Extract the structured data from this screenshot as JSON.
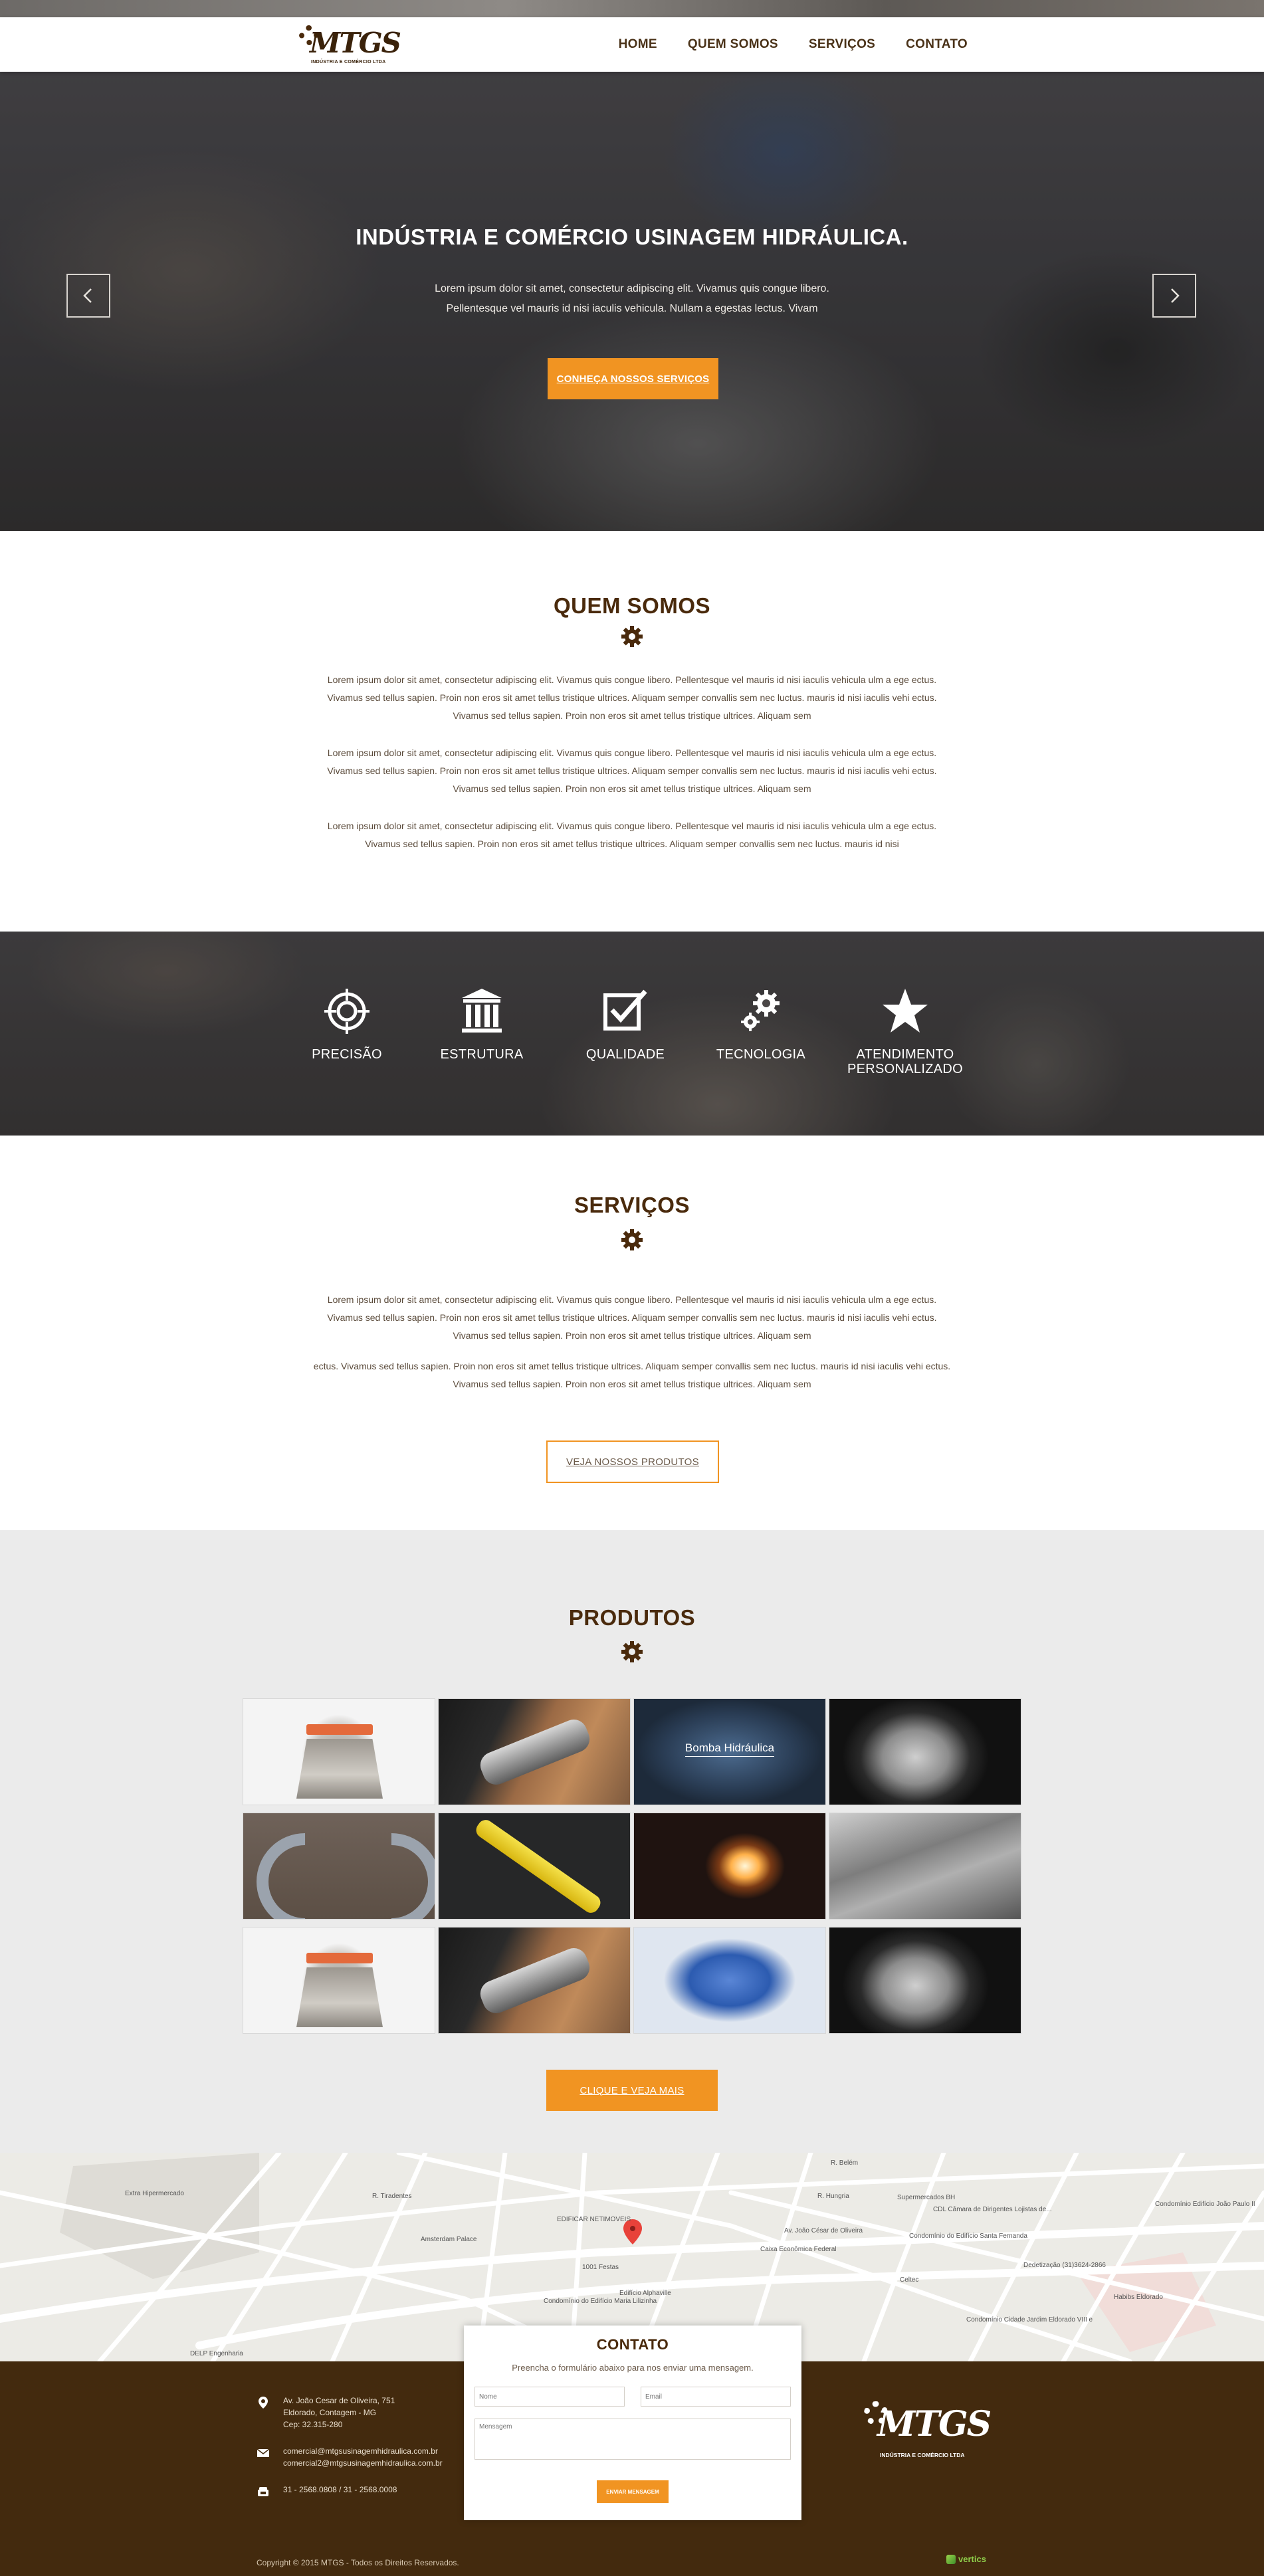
{
  "brand": {
    "name": "MTGS",
    "tagline": "INDÚSTRIA E COMÉRCIO LTDA"
  },
  "nav": {
    "items": [
      {
        "label": "HOME"
      },
      {
        "label": "QUEM SOMOS"
      },
      {
        "label": "SERVIÇOS"
      },
      {
        "label": "CONTATO"
      }
    ]
  },
  "hero": {
    "title": "INDÚSTRIA E COMÉRCIO USINAGEM HIDRÁULICA.",
    "text": "Lorem ipsum dolor sit amet, consectetur adipiscing elit. Vivamus quis congue libero. Pellentesque vel mauris id nisi iaculis vehicula. Nullam a egestas lectus. Vivam",
    "cta_label": "CONHEÇA NOSSOS SERVIÇOS",
    "prev_icon": "chevron-left-icon",
    "next_icon": "chevron-right-icon"
  },
  "about": {
    "title": "QUEM SOMOS",
    "paragraphs": [
      "Lorem ipsum dolor sit amet, consectetur adipiscing elit. Vivamus quis congue libero. Pellentesque vel mauris id nisi iaculis vehicula ulm a ege ectus. Vivamus sed tellus sapien. Proin non eros sit amet tellus tristique ultrices. Aliquam semper convallis sem nec luctus. mauris id nisi iaculis vehi  ectus. Vivamus sed tellus sapien. Proin non eros sit amet tellus tristique ultrices. Aliquam sem",
      "Lorem ipsum dolor sit amet, consectetur adipiscing elit. Vivamus quis congue libero. Pellentesque vel mauris id nisi iaculis vehicula ulm a ege ectus. Vivamus sed tellus sapien. Proin non eros sit amet tellus tristique ultrices. Aliquam semper convallis sem nec luctus. mauris id nisi iaculis vehi  ectus. Vivamus sed tellus sapien. Proin non eros sit amet tellus tristique ultrices. Aliquam sem",
      "Lorem ipsum dolor sit amet, consectetur adipiscing elit. Vivamus quis congue libero. Pellentesque vel mauris id nisi iaculis vehicula ulm a ege ectus. Vivamus sed tellus sapien. Proin non eros sit amet tellus tristique ultrices. Aliquam semper convallis sem nec luctus. mauris id nisi"
    ]
  },
  "features": [
    {
      "label": "PRECISÃO",
      "icon": "crosshair-icon"
    },
    {
      "label": "ESTRUTURA",
      "icon": "building-columns-icon"
    },
    {
      "label": "QUALIDADE",
      "icon": "checkbox-icon"
    },
    {
      "label": "TECNOLOGIA",
      "icon": "gears-icon"
    },
    {
      "label": "ATENDIMENTO PERSONALIZADO",
      "icon": "star-icon"
    }
  ],
  "services": {
    "title": "SERVIÇOS",
    "paragraphs": [
      "Lorem ipsum dolor sit amet, consectetur adipiscing elit. Vivamus quis congue libero. Pellentesque vel mauris id nisi iaculis vehicula ulm a ege ectus. Vivamus sed tellus sapien. Proin non eros sit amet tellus tristique ultrices. Aliquam semper convallis sem nec luctus. mauris id nisi iaculis vehi  ectus. Vivamus sed tellus sapien. Proin non eros sit amet tellus tristique ultrices. Aliquam sem",
      "ectus. Vivamus sed tellus sapien. Proin non eros sit amet tellus tristique ultrices. Aliquam semper convallis sem nec luctus. mauris id nisi iaculis vehi  ectus. Vivamus sed tellus sapien. Proin non eros sit amet tellus tristique ultrices. Aliquam sem"
    ],
    "button_label": "VEJA NOSSOS PRODUTOS"
  },
  "products": {
    "title": "PRODUTOS",
    "highlight_caption": "Bomba Hidráulica",
    "button_label": "CLIQUE E VEJA MAIS"
  },
  "map": {
    "labels": [
      "Extra Hipermercado",
      "Av. João César de Oliveira",
      "Amsterdam Palace",
      "EDIFICAR NETIMOVEIS",
      "1001 Festas",
      "Caixa Econômica Federal",
      "Supermercados BH",
      "CDL Câmara de Dirigentes Lojistas de...",
      "Condomínio do Edifício Santa Fernanda",
      "Condomínio Edifício João Paulo II",
      "Dedetização (31)3624-2866",
      "Habibs Eldorado",
      "Condomínio Cidade Jardim Eldorado VIII e",
      "Edifício Alphaville",
      "Condomínio do Edifício Maria Lilizinha",
      "DELP Engenharia",
      "Celtec",
      "R. Hungria",
      "R. Tiradentes",
      "R. Belém"
    ]
  },
  "contact_form": {
    "title": "CONTATO",
    "subtitle": "Preencha o formulário abaixo para nos enviar uma mensagem.",
    "name_placeholder": "Nome",
    "email_placeholder": "Email",
    "message_placeholder": "Mensagem",
    "submit_label": "ENVIAR MENSAGEM"
  },
  "footer": {
    "address": [
      "Av. João Cesar de Oliveira, 751",
      "Eldorado, Contagem - MG",
      "Cep: 32.315-280"
    ],
    "emails": [
      "comercial@mtgsusinagemhidraulica.com.br",
      "comercial2@mtgsusinagemhidraulica.com.br"
    ],
    "phones": "31 - 2568.0808  /  31 - 2568.0008",
    "copyright": "Copyright © 2015 MTGS - Todos os Direitos Reservados.",
    "developer": "vertics"
  },
  "colors": {
    "accent": "#f19422",
    "brand_brown": "#4a2a0c",
    "footer_bg": "#432a0e",
    "products_bg": "#ebebeb"
  }
}
